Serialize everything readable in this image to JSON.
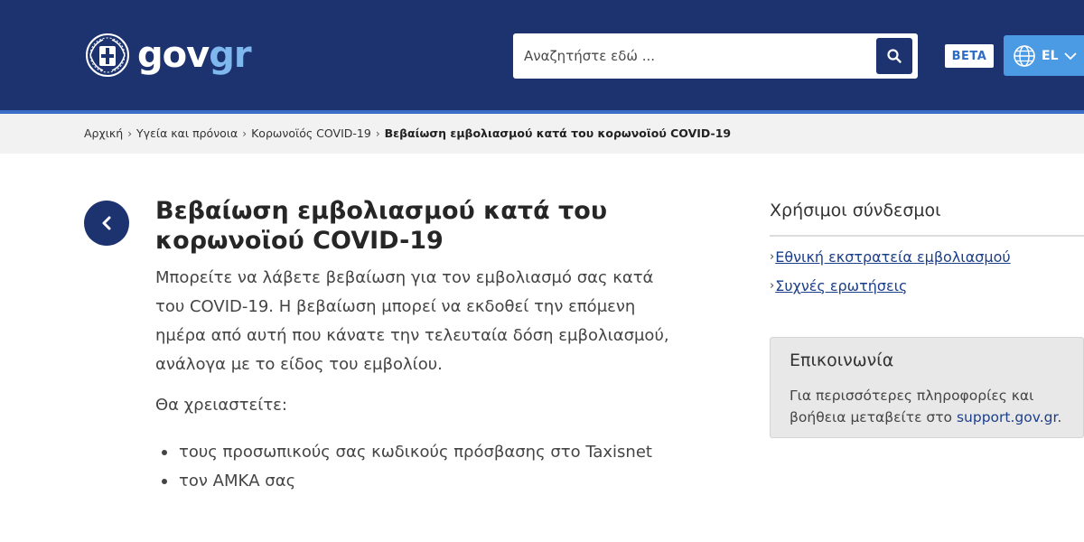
{
  "header": {
    "logo_text_gov": "gov",
    "logo_text_gr": "gr",
    "search_placeholder": "Αναζητήστε εδώ ...",
    "beta_label": "BETA",
    "language": "EL"
  },
  "breadcrumb": {
    "items": [
      "Αρχική",
      "Υγεία και πρόνοια",
      "Κορωνοϊός COVID-19"
    ],
    "current": "Βεβαίωση εμβολιασμού κατά του κορωνοϊού COVID-19"
  },
  "main": {
    "title": "Βεβαίωση εμβολιασμού κατά του κορωνοϊού COVID-19",
    "intro": "Μπορείτε να λάβετε βεβαίωση για τον εμβολιασμό σας κατά του COVID-19. Η βεβαίωση μπορεί να εκδοθεί την επόμενη ημέρα από αυτή που κάνατε την τελευταία δόση εμβολιασμού, ανάλογα με το είδος του εμβολίου.",
    "need_label": "Θα χρειαστείτε:",
    "requirements": [
      "τους προσωπικούς σας κωδικούς πρόσβασης στο Taxisnet",
      "τον ΑΜΚΑ σας"
    ]
  },
  "sidebar": {
    "links_title": "Χρήσιμοι σύνδεσμοι",
    "links": [
      "Εθνική εκστρατεία εμβολιασμού",
      "Συχνές ερωτήσεις"
    ],
    "contact_title": "Επικοινωνία",
    "contact_text": "Για περισσότερες πληροφορίες και βοήθεια μεταβείτε στο",
    "contact_link": "support.gov.gr",
    "contact_end": "."
  },
  "colors": {
    "header_bg": "#1c3370",
    "accent_light": "#4b9ae4",
    "link": "#1c3f8a"
  },
  "icons": [
    "emblem-icon",
    "search-icon",
    "globe-icon",
    "chevron-down-icon",
    "chevron-left-icon"
  ]
}
